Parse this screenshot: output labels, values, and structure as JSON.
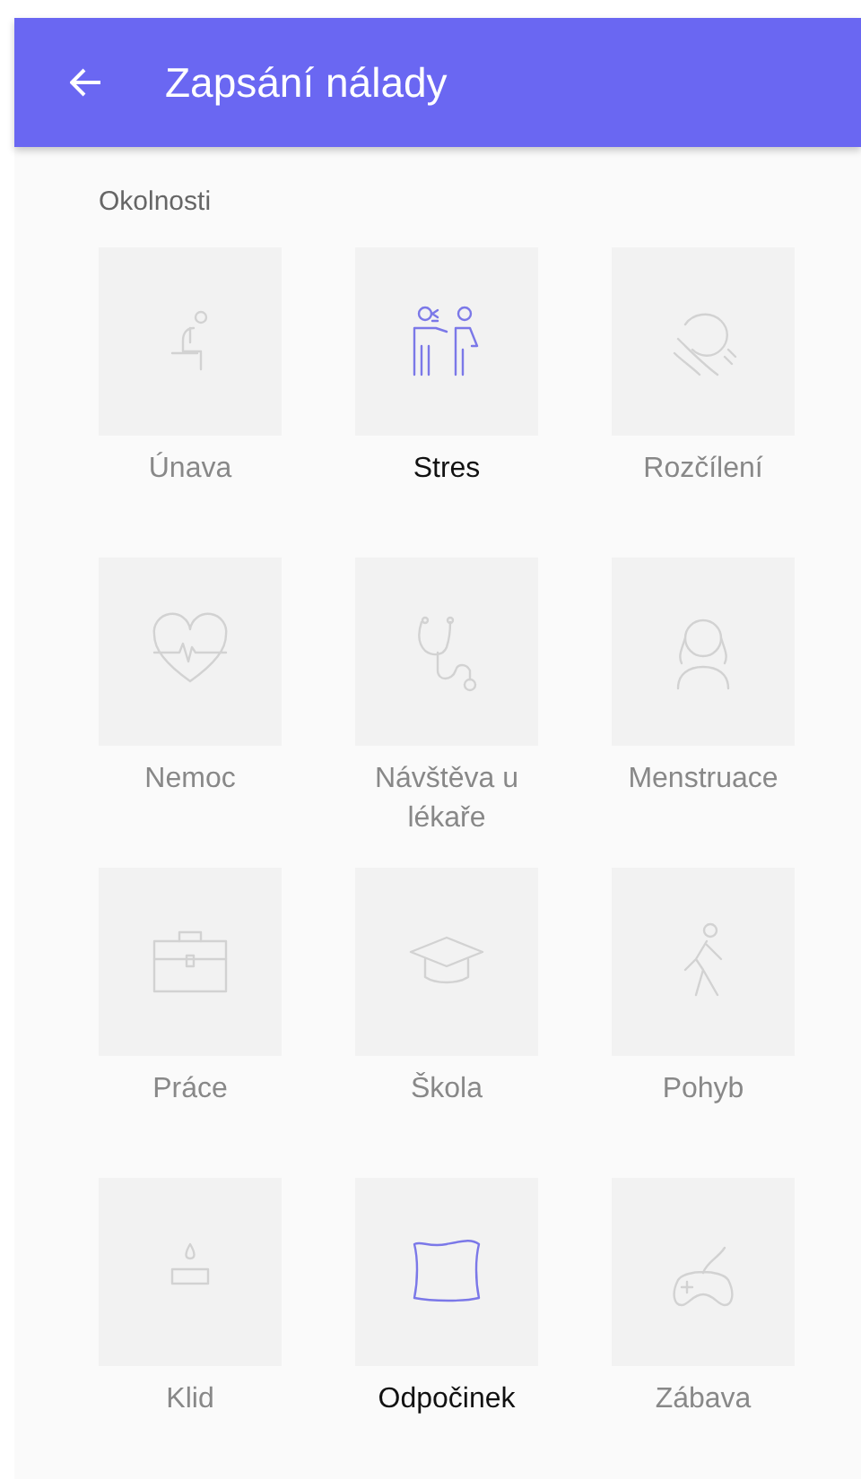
{
  "app_bar": {
    "title": "Zapsání nálady"
  },
  "section": {
    "title": "Okolnosti"
  },
  "items": [
    {
      "label": "Únava",
      "selected": false
    },
    {
      "label": "Stres",
      "selected": true
    },
    {
      "label": "Rozčílení",
      "selected": false
    },
    {
      "label": "Nemoc",
      "selected": false
    },
    {
      "label": "Návštěva u lékaře",
      "selected": false
    },
    {
      "label": "Menstruace",
      "selected": false
    },
    {
      "label": "Práce",
      "selected": false
    },
    {
      "label": "Škola",
      "selected": false
    },
    {
      "label": "Pohyb",
      "selected": false
    },
    {
      "label": "Klid",
      "selected": false
    },
    {
      "label": "Odpočinek",
      "selected": true
    },
    {
      "label": "Zábava",
      "selected": false
    }
  ]
}
